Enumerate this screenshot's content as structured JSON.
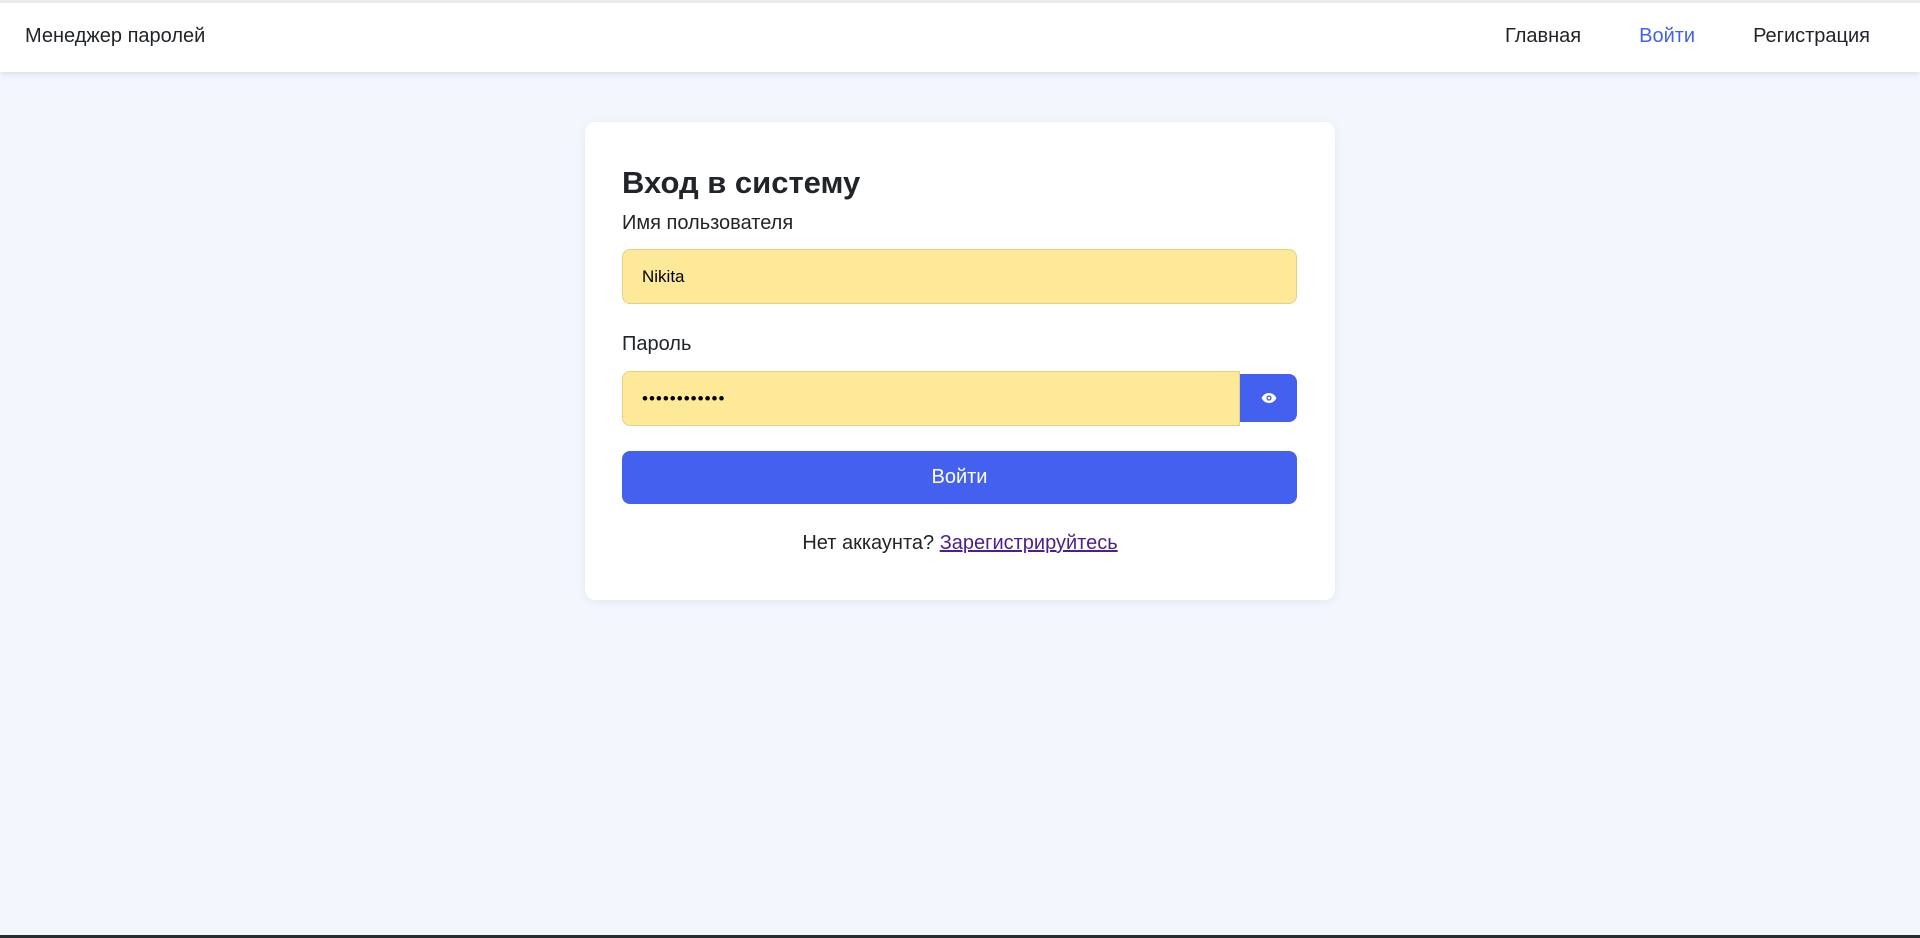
{
  "navbar": {
    "brand": "Менеджер паролей",
    "links": [
      {
        "label": "Главная",
        "active": false
      },
      {
        "label": "Войти",
        "active": true
      },
      {
        "label": "Регистрация",
        "active": false
      }
    ]
  },
  "login": {
    "title": "Вход в систему",
    "username_label": "Имя пользователя",
    "username_value": "Nikita",
    "password_label": "Пароль",
    "password_value": "............",
    "toggle_icon": "eye-icon",
    "submit_label": "Войти",
    "no_account_text": "Нет аккаунта?",
    "register_link": "Зарегистрируйтесь"
  },
  "colors": {
    "accent": "#4361ee",
    "input_autofill": "#fee999",
    "page_bg": "#f2f6fd",
    "link_visited": "#4b1f8c"
  }
}
